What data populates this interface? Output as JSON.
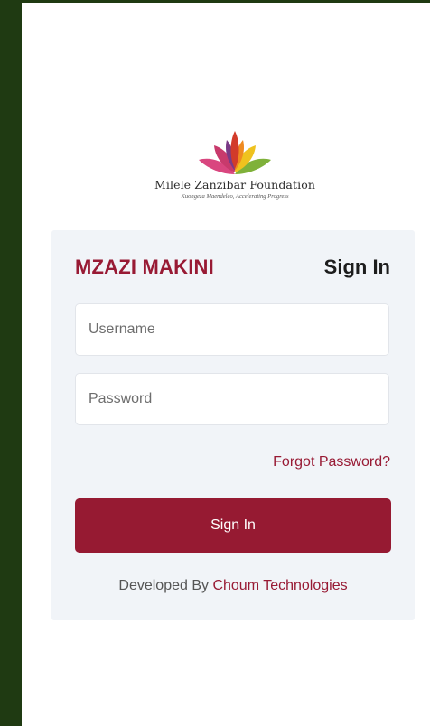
{
  "colors": {
    "frame": "#1f3a12",
    "brand": "#981a34",
    "button_bg": "#961a32",
    "card_bg": "#f1f4f8"
  },
  "logo": {
    "icon": "lotus-logo-icon",
    "org_name": "Milele Zanzibar Foundation",
    "tagline": "Kuongeza Maendeleo, Accelerating Progress"
  },
  "login": {
    "brand": "MZAZI MAKINI",
    "heading": "Sign In",
    "username_placeholder": "Username",
    "password_placeholder": "Password",
    "forgot_password": "Forgot Password?",
    "submit_label": "Sign In"
  },
  "footer": {
    "prefix": "Developed By ",
    "company": "Choum Technologies"
  }
}
